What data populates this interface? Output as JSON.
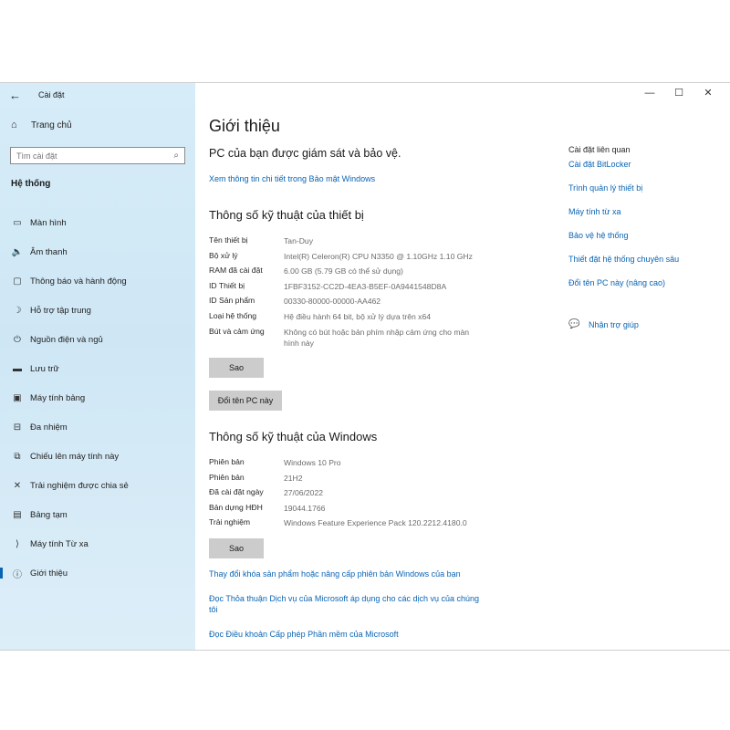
{
  "window": {
    "title": "Cài đặt",
    "controls": {
      "minimize": "—",
      "maximize": "☐",
      "close": "✕"
    }
  },
  "sidebar": {
    "home": "Trang chủ",
    "search_placeholder": "Tìm cài đặt",
    "section": "Hệ thống",
    "items": [
      {
        "label": "Màn hình",
        "icon": "monitor-icon",
        "glyph": "▭"
      },
      {
        "label": "Âm thanh",
        "icon": "speaker-icon",
        "glyph": "🔈"
      },
      {
        "label": "Thông báo và hành động",
        "icon": "notification-icon",
        "glyph": "▢"
      },
      {
        "label": "Hỗ trợ tập trung",
        "icon": "moon-icon",
        "glyph": "☽"
      },
      {
        "label": "Nguồn điện và ngủ",
        "icon": "power-icon",
        "glyph": "⏻"
      },
      {
        "label": "Lưu trữ",
        "icon": "storage-icon",
        "glyph": "▬"
      },
      {
        "label": "Máy tính bảng",
        "icon": "tablet-icon",
        "glyph": "▣"
      },
      {
        "label": "Đa nhiệm",
        "icon": "multitask-icon",
        "glyph": "⊟"
      },
      {
        "label": "Chiếu lên máy tính này",
        "icon": "projecting-icon",
        "glyph": "⧉"
      },
      {
        "label": "Trải nghiệm được chia sẻ",
        "icon": "shared-icon",
        "glyph": "✕"
      },
      {
        "label": "Bảng tạm",
        "icon": "clipboard-icon",
        "glyph": "▤"
      },
      {
        "label": "Máy tính Từ xa",
        "icon": "remote-desktop-icon",
        "glyph": "⟩"
      },
      {
        "label": "Giới thiệu",
        "icon": "info-icon",
        "glyph": "ⓘ"
      }
    ]
  },
  "main": {
    "title": "Giới thiệu",
    "subtitle": "PC của bạn được giám sát và bảo vệ.",
    "security_link": "Xem thông tin chi tiết trong Bảo mật Windows",
    "device_specs": {
      "heading": "Thông số kỹ thuật của thiết bị",
      "rows": [
        {
          "k": "Tên thiết bị",
          "v": "Tan-Duy"
        },
        {
          "k": "Bộ xử lý",
          "v": "Intel(R) Celeron(R) CPU N3350 @ 1.10GHz   1.10 GHz"
        },
        {
          "k": "RAM đã cài đặt",
          "v": "6.00 GB (5.79 GB có thể sử dụng)"
        },
        {
          "k": "ID Thiết bị",
          "v": "1FBF3152-CC2D-4EA3-B5EF-0A9441548D8A"
        },
        {
          "k": "ID Sản phẩm",
          "v": "00330-80000-00000-AA462"
        },
        {
          "k": "Loại hệ thống",
          "v": "Hệ điều hành 64 bit, bộ xử lý dựa trên x64"
        },
        {
          "k": "Bút và cảm ứng",
          "v": "Không có bút hoặc bản phím nhập cảm ứng cho màn hình này"
        }
      ],
      "copy_button": "Sao",
      "rename_button": "Đổi tên PC này"
    },
    "windows_specs": {
      "heading": "Thông số kỹ thuật của Windows",
      "rows": [
        {
          "k": "Phiên bản",
          "v": "Windows 10 Pro"
        },
        {
          "k": "Phiên bản",
          "v": "21H2"
        },
        {
          "k": "Đã cài đặt ngày",
          "v": "27/06/2022"
        },
        {
          "k": "Bản dựng HĐH",
          "v": "19044.1766"
        },
        {
          "k": "Trải nghiệm",
          "v": "Windows Feature Experience Pack 120.2212.4180.0"
        }
      ],
      "copy_button": "Sao"
    },
    "bottom_links": [
      "Thay đổi khóa sản phẩm hoặc nâng cấp phiên bản Windows của bạn",
      "Đọc Thỏa thuận Dịch vụ của Microsoft áp dụng cho các dịch vụ của chúng tôi",
      "Đọc Điều khoản Cấp phép Phần mềm của Microsoft"
    ]
  },
  "related": {
    "title": "Cài đặt liên quan",
    "links": [
      "Cài đặt BitLocker",
      "Trình quản lý thiết bị",
      "Máy tính từ xa",
      "Bảo vệ hệ thống",
      "Thiết đặt hệ thống chuyên sâu",
      "Đổi tên PC này (nâng cao)"
    ],
    "help": "Nhận trợ giúp"
  }
}
